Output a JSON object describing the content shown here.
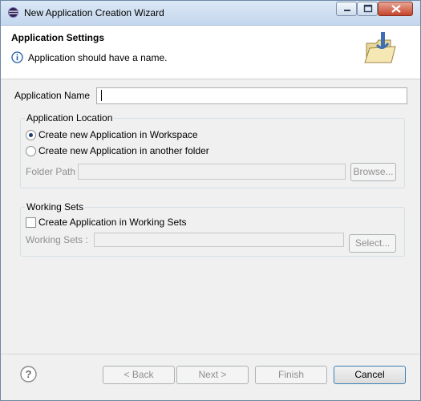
{
  "window": {
    "title": "New Application Creation Wizard"
  },
  "header": {
    "title": "Application Settings",
    "message": "Application should have a name."
  },
  "form": {
    "application_name_label": "Application Name",
    "application_name_value": "",
    "location_group": {
      "title": "Application Location",
      "option_workspace": "Create new Application in Workspace",
      "option_other_folder": "Create new Application in another folder",
      "selected": "workspace",
      "folder_path_label": "Folder Path",
      "folder_path_value": "",
      "browse_label": "Browse..."
    },
    "working_sets_group": {
      "title": "Working Sets",
      "checkbox_label": "Create Application in Working Sets",
      "checked": false,
      "working_sets_label": "Working Sets :",
      "working_sets_value": "",
      "select_label": "Select..."
    }
  },
  "footer": {
    "back_label": "< Back",
    "next_label": "Next >",
    "finish_label": "Finish",
    "cancel_label": "Cancel"
  }
}
